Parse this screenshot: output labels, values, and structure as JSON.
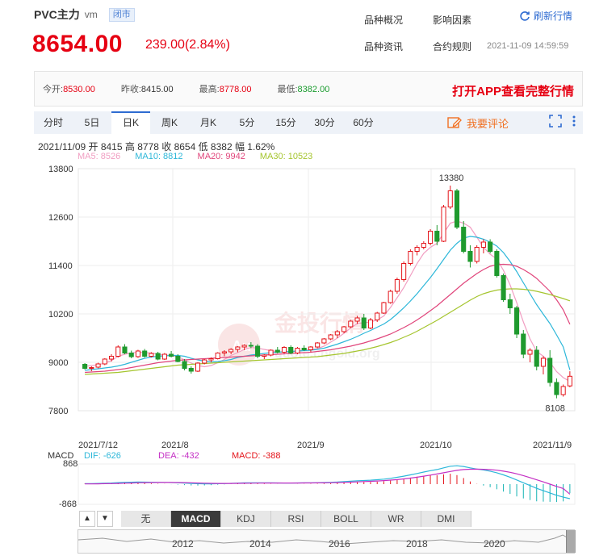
{
  "header": {
    "name": "PVC主力",
    "suffix": "vm",
    "status": "闭市",
    "price": "8654.00",
    "change": "239.00(2.84%)",
    "links": [
      "品种概况",
      "影响因素",
      "品种资讯",
      "合约规则"
    ],
    "refresh_label": "刷新行情",
    "timestamp": "2021-11-09 14:59:59"
  },
  "quote": {
    "open_label": "今开:",
    "open": "8530.00",
    "prev_label": "昨收:",
    "prev": "8415.00",
    "high_label": "最高:",
    "high": "8778.00",
    "low_label": "最低:",
    "low": "8382.00",
    "promo": "打开APP查看完整行情"
  },
  "tabs": [
    "分时",
    "5日",
    "日K",
    "周K",
    "月K",
    "5分",
    "15分",
    "30分",
    "60分"
  ],
  "active_tab": "日K",
  "comment_label": "我要评论",
  "info": "2021/11/09  开 8415  高 8778  收 8654  低 8382  幅 1.62%",
  "ma": [
    {
      "label": "MA5: 8526",
      "color": "#f19ec2"
    },
    {
      "label": "MA10: 8812",
      "color": "#2db7d9"
    },
    {
      "label": "MA20: 9942",
      "color": "#e0457b"
    },
    {
      "label": "MA30: 10523",
      "color": "#a5c52e"
    }
  ],
  "macd_info": {
    "title": "MACD",
    "dif": "DIF: -626",
    "dea": "DEA: -432",
    "macd": "MACD: -388"
  },
  "bottom_tabs": [
    "无",
    "MACD",
    "KDJ",
    "RSI",
    "BOLL",
    "WR",
    "DMI"
  ],
  "active_bottom_tab": "MACD",
  "nav_years": [
    "2012",
    "2014",
    "2016",
    "2018",
    "2020"
  ],
  "watermark": {
    "brand": "金投行情",
    "site": "quote.cngold.org",
    "badge": "Au"
  },
  "chart_data": {
    "type": "candlestick",
    "ylim": [
      7800,
      13800
    ],
    "yticks": [
      13800,
      12600,
      11400,
      10200,
      9000,
      7800
    ],
    "xticks": [
      "2021/7/12",
      "2021/8",
      "2021/9",
      "2021/10",
      "2021/11/9"
    ],
    "annotations": {
      "max": "13380",
      "min": "8108"
    },
    "candles": [
      [
        8950,
        8980,
        8820,
        8850
      ],
      [
        8850,
        8900,
        8780,
        8870
      ],
      [
        8880,
        8990,
        8850,
        8960
      ],
      [
        8960,
        9100,
        8930,
        9080
      ],
      [
        9080,
        9200,
        9020,
        9150
      ],
      [
        9150,
        9420,
        9120,
        9380
      ],
      [
        9380,
        9450,
        9200,
        9230
      ],
      [
        9230,
        9290,
        9100,
        9140
      ],
      [
        9140,
        9310,
        9110,
        9280
      ],
      [
        9280,
        9330,
        9120,
        9150
      ],
      [
        9150,
        9250,
        9120,
        9220
      ],
      [
        9220,
        9260,
        9050,
        9080
      ],
      [
        9080,
        9230,
        9060,
        9200
      ],
      [
        9200,
        9280,
        9120,
        9150
      ],
      [
        9150,
        9200,
        9000,
        9020
      ],
      [
        9020,
        9080,
        8800,
        8850
      ],
      [
        8850,
        8900,
        8720,
        8780
      ],
      [
        8780,
        9000,
        8760,
        8980
      ],
      [
        8980,
        9080,
        8950,
        9060
      ],
      [
        9060,
        9120,
        9000,
        9090
      ],
      [
        9090,
        9250,
        9070,
        9230
      ],
      [
        9230,
        9300,
        9150,
        9260
      ],
      [
        9260,
        9350,
        9200,
        9320
      ],
      [
        9320,
        9400,
        9250,
        9380
      ],
      [
        9380,
        9450,
        9300,
        9420
      ],
      [
        9420,
        9500,
        9350,
        9400
      ],
      [
        9400,
        9450,
        9100,
        9150
      ],
      [
        9150,
        9200,
        9080,
        9180
      ],
      [
        9180,
        9320,
        9150,
        9300
      ],
      [
        9300,
        9380,
        9220,
        9250
      ],
      [
        9250,
        9400,
        9220,
        9370
      ],
      [
        9370,
        9420,
        9200,
        9230
      ],
      [
        9230,
        9380,
        9200,
        9350
      ],
      [
        9350,
        9420,
        9280,
        9310
      ],
      [
        9310,
        9400,
        9250,
        9380
      ],
      [
        9380,
        9500,
        9350,
        9480
      ],
      [
        9480,
        9600,
        9450,
        9580
      ],
      [
        9580,
        9700,
        9550,
        9680
      ],
      [
        9680,
        9800,
        9600,
        9760
      ],
      [
        9760,
        9900,
        9720,
        9880
      ],
      [
        9880,
        10050,
        9850,
        10020
      ],
      [
        10020,
        10150,
        9950,
        10100
      ],
      [
        10100,
        10200,
        9800,
        9850
      ],
      [
        9850,
        10100,
        9820,
        10050
      ],
      [
        10050,
        10250,
        10000,
        10220
      ],
      [
        10220,
        10500,
        10200,
        10480
      ],
      [
        10480,
        10800,
        10450,
        10760
      ],
      [
        10760,
        11100,
        10700,
        11050
      ],
      [
        11050,
        11500,
        11000,
        11450
      ],
      [
        11450,
        11800,
        11400,
        11750
      ],
      [
        11750,
        11900,
        11650,
        11850
      ],
      [
        11850,
        12000,
        11800,
        11950
      ],
      [
        11950,
        12300,
        11900,
        12250
      ],
      [
        12250,
        12400,
        11900,
        12000
      ],
      [
        12000,
        12900,
        11980,
        12850
      ],
      [
        12850,
        13380,
        12800,
        13250
      ],
      [
        13250,
        13300,
        12300,
        12350
      ],
      [
        12350,
        12500,
        11700,
        11750
      ],
      [
        11750,
        11900,
        11350,
        11500
      ],
      [
        11500,
        11900,
        11450,
        11850
      ],
      [
        11850,
        12050,
        11700,
        11980
      ],
      [
        11980,
        12050,
        11700,
        11750
      ],
      [
        11750,
        11800,
        11100,
        11150
      ],
      [
        11150,
        11200,
        10500,
        10550
      ],
      [
        10550,
        10700,
        10200,
        10350
      ],
      [
        10350,
        10400,
        9600,
        9700
      ],
      [
        9700,
        9800,
        9100,
        9200
      ],
      [
        9200,
        9350,
        9000,
        9300
      ],
      [
        9300,
        9400,
        8800,
        8900
      ],
      [
        8900,
        9150,
        8700,
        9100
      ],
      [
        9100,
        9300,
        8400,
        8500
      ],
      [
        8500,
        8600,
        8108,
        8200
      ],
      [
        8200,
        8450,
        8150,
        8400
      ],
      [
        8415,
        8778,
        8382,
        8654
      ]
    ],
    "ma5": [
      8900,
      8920,
      8940,
      8980,
      9040,
      9150,
      9200,
      9230,
      9250,
      9240,
      9230,
      9200,
      9180,
      9170,
      9140,
      9060,
      8980,
      8920,
      8890,
      8920,
      8990,
      9070,
      9170,
      9240,
      9320,
      9370,
      9350,
      9320,
      9290,
      9260,
      9250,
      9260,
      9280,
      9300,
      9310,
      9340,
      9400,
      9500,
      9600,
      9720,
      9850,
      9960,
      9980,
      10000,
      10050,
      10150,
      10360,
      10600,
      10850,
      11150,
      11450,
      11700,
      11850,
      11950,
      12200,
      12450,
      12500,
      12450,
      12350,
      12100,
      11850,
      11680,
      11560,
      11280,
      10920,
      10480,
      10000,
      9580,
      9270,
      9150,
      9000,
      8770,
      8620,
      8526
    ],
    "ma10": [
      8800,
      8820,
      8840,
      8860,
      8880,
      8910,
      8950,
      9000,
      9050,
      9100,
      9130,
      9150,
      9160,
      9170,
      9170,
      9150,
      9100,
      9060,
      9030,
      9010,
      9020,
      9040,
      9070,
      9120,
      9150,
      9180,
      9200,
      9220,
      9240,
      9250,
      9260,
      9270,
      9280,
      9290,
      9300,
      9320,
      9350,
      9400,
      9450,
      9510,
      9570,
      9640,
      9720,
      9790,
      9870,
      9950,
      10060,
      10200,
      10350,
      10520,
      10700,
      10900,
      11100,
      11320,
      11550,
      11780,
      11950,
      12080,
      12120,
      12100,
      12050,
      11980,
      11880,
      11720,
      11500,
      11250,
      10970,
      10700,
      10430,
      10190,
      9960,
      9680,
      9380,
      8812
    ],
    "ma20": [
      8750,
      8760,
      8770,
      8780,
      8800,
      8820,
      8840,
      8870,
      8900,
      8930,
      8960,
      8990,
      9010,
      9030,
      9050,
      9060,
      9070,
      9080,
      9090,
      9100,
      9110,
      9120,
      9130,
      9140,
      9150,
      9160,
      9170,
      9180,
      9190,
      9200,
      9210,
      9220,
      9230,
      9240,
      9250,
      9270,
      9290,
      9310,
      9340,
      9370,
      9400,
      9440,
      9480,
      9530,
      9580,
      9640,
      9700,
      9780,
      9860,
      9950,
      10050,
      10160,
      10280,
      10400,
      10540,
      10680,
      10820,
      10960,
      11080,
      11200,
      11300,
      11380,
      11420,
      11430,
      11420,
      11380,
      11300,
      11200,
      11080,
      10920,
      10760,
      10550,
      10300,
      9942
    ],
    "ma30": [
      8700,
      8710,
      8720,
      8730,
      8740,
      8750,
      8770,
      8790,
      8810,
      8830,
      8850,
      8870,
      8890,
      8910,
      8930,
      8940,
      8950,
      8960,
      8970,
      8980,
      8990,
      9000,
      9010,
      9020,
      9030,
      9040,
      9050,
      9060,
      9070,
      9080,
      9090,
      9100,
      9110,
      9120,
      9130,
      9140,
      9160,
      9180,
      9200,
      9220,
      9250,
      9280,
      9310,
      9350,
      9390,
      9440,
      9490,
      9550,
      9620,
      9690,
      9770,
      9860,
      9950,
      10040,
      10140,
      10240,
      10340,
      10440,
      10540,
      10630,
      10700,
      10750,
      10790,
      10810,
      10820,
      10820,
      10810,
      10790,
      10760,
      10720,
      10680,
      10630,
      10580,
      10523
    ],
    "macd": {
      "ylim": [
        -868,
        868
      ],
      "dif": [
        20,
        25,
        30,
        40,
        50,
        65,
        80,
        85,
        90,
        88,
        85,
        80,
        75,
        70,
        60,
        45,
        30,
        20,
        15,
        15,
        20,
        25,
        35,
        45,
        55,
        60,
        60,
        58,
        55,
        52,
        50,
        50,
        52,
        55,
        58,
        62,
        70,
        80,
        92,
        108,
        125,
        145,
        155,
        170,
        190,
        215,
        250,
        295,
        345,
        400,
        460,
        520,
        580,
        630,
        700,
        770,
        790,
        760,
        700,
        650,
        610,
        560,
        490,
        400,
        300,
        180,
        60,
        -60,
        -180,
        -280,
        -380,
        -480,
        -560,
        -626
      ],
      "dea": [
        10,
        12,
        15,
        20,
        25,
        30,
        40,
        50,
        60,
        65,
        70,
        72,
        72,
        72,
        70,
        65,
        58,
        50,
        42,
        36,
        32,
        30,
        31,
        33,
        37,
        42,
        46,
        48,
        50,
        50,
        50,
        50,
        50,
        51,
        52,
        54,
        57,
        62,
        68,
        76,
        86,
        98,
        110,
        122,
        136,
        152,
        172,
        196,
        226,
        260,
        300,
        344,
        390,
        438,
        490,
        546,
        595,
        628,
        642,
        645,
        640,
        625,
        600,
        560,
        510,
        444,
        367,
        282,
        189,
        96,
        0,
        -96,
        -189,
        -432
      ]
    }
  }
}
